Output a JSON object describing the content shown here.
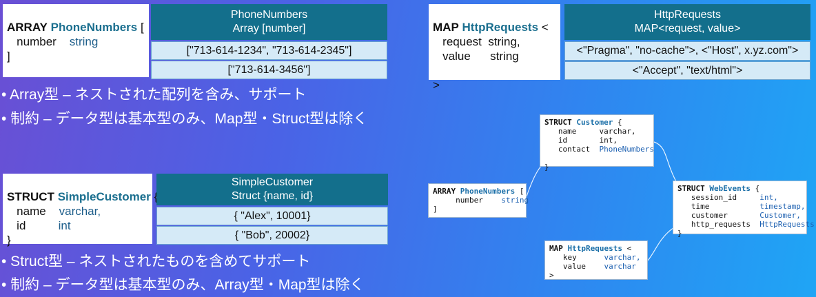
{
  "array_def": {
    "kw": "ARRAY",
    "name": "PhoneNumbers",
    "open": " [",
    "field": "number",
    "type": "string",
    "close": "]"
  },
  "array_table": {
    "title": "PhoneNumbers",
    "subtitle": "Array [number]",
    "rows": [
      "[\"713-614-1234\", \"713-614-2345\"]",
      "[\"713-614-3456\"]"
    ]
  },
  "map_def": {
    "kw": "MAP",
    "name": "HttpRequests",
    "open": " <",
    "f1": "request",
    "t1": "string,",
    "f2": "value",
    "t2": "string",
    "close": ">"
  },
  "map_table": {
    "title": "HttpRequests",
    "subtitle": "MAP<request, value>",
    "rows": [
      "<\"Pragma\", \"no-cache\">, <\"Host\", x.yz.com\">",
      "<\"Accept\", \"text/html\">"
    ]
  },
  "struct_def": {
    "kw": "STRUCT",
    "name": "SimpleCustomer",
    "open": " {",
    "f1": "name",
    "t1": "varchar,",
    "f2": "id",
    "t2": "int",
    "close": "}"
  },
  "struct_table": {
    "title": "SimpleCustomer",
    "subtitle": "Struct {name, id}",
    "rows": [
      "{ \"Alex\", 10001}",
      "{ \"Bob\",  20002}"
    ]
  },
  "bullets": {
    "b1": "• Array型 – ネストされた配列を含み、サポート",
    "b2": "• 制約 – データ型は基本型のみ、Map型・Struct型は除く",
    "b3": "• Struct型 – ネストされたものを含めてサポート",
    "b4": "• 制約 – データ型は基本型のみ、Array型・Map型は除く"
  },
  "diagram": {
    "customer": {
      "kw": "STRUCT",
      "name": "Customer",
      "open": " {",
      "rows": [
        [
          "name",
          "varchar,"
        ],
        [
          "id",
          "int,"
        ],
        [
          "contact",
          "PhoneNumbers"
        ]
      ],
      "close": "}"
    },
    "phones": {
      "kw": "ARRAY",
      "name": "PhoneNumbers",
      "open": " [",
      "rows": [
        [
          "number",
          "string"
        ]
      ],
      "close": "]"
    },
    "webevents": {
      "kw": "STRUCT",
      "name": "WebEvents",
      "open": " {",
      "rows": [
        [
          "session_id",
          "int,"
        ],
        [
          "time",
          "timestamp,"
        ],
        [
          "customer",
          "Customer,"
        ],
        [
          "http_requests",
          "HttpRequests"
        ]
      ],
      "close": "}"
    },
    "httpreq": {
      "kw": "MAP",
      "name": "HttpRequests",
      "open": " <",
      "rows": [
        [
          "key",
          "varchar,"
        ],
        [
          "value",
          "varchar"
        ]
      ],
      "close": ">"
    }
  },
  "colors": {
    "header": "#136f8c",
    "row_bg": "#d5eaf7",
    "type_name": "#1b6f8f"
  }
}
